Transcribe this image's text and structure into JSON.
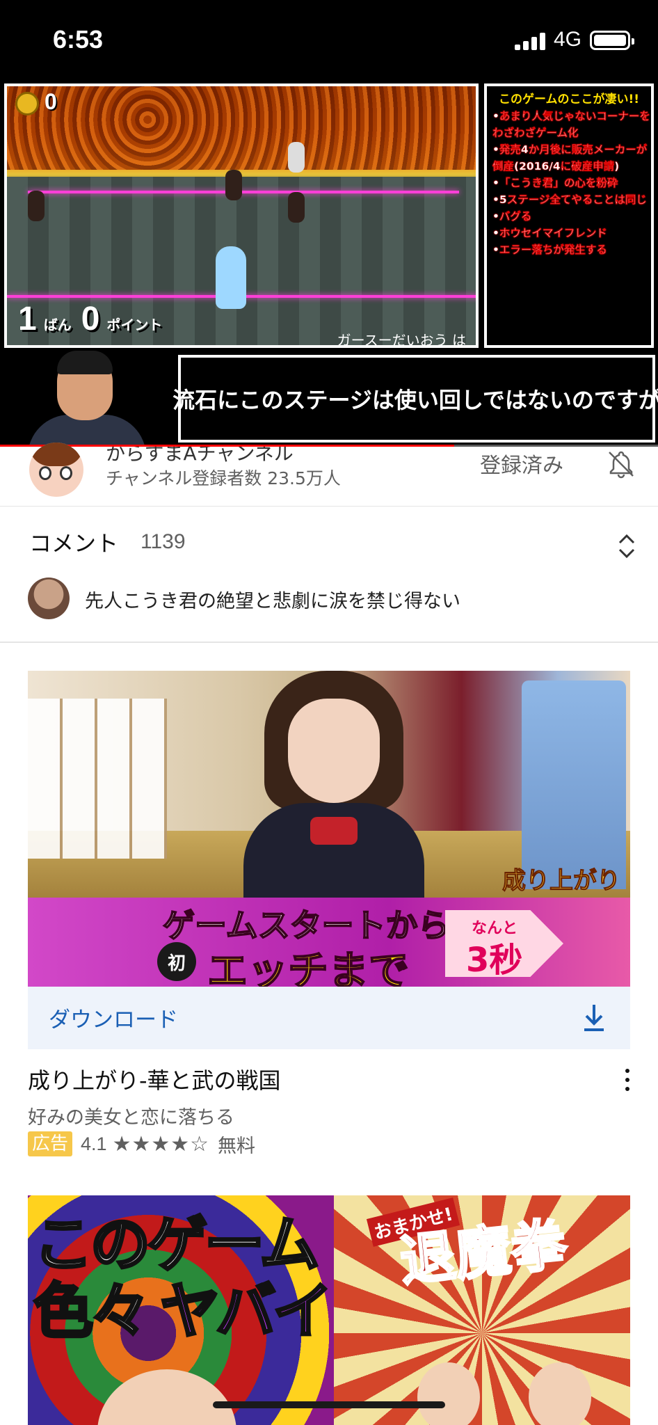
{
  "status_bar": {
    "time": "6:53",
    "network": "4G"
  },
  "video": {
    "hud_coins": "0",
    "hud_rank": "1",
    "hud_rank_unit": "ばん",
    "hud_points": "0",
    "hud_points_unit": "ポイント",
    "game_caption": "ガースーだいおう は",
    "info_panel": {
      "title": "このゲームのここが凄い!!",
      "lines": [
        "•あまり人気じゃないコーナーを",
        "  わざわざゲーム化",
        "•発売4か月後に販売メーカーが",
        "  倒産(2016/4に破産申請)",
        "•「こうき君」の心を粉砕",
        "•5ステージ全てやることは同じ",
        "•バグる",
        "•ホウセイマイフレンド",
        "•エラー落ちが発生する"
      ]
    },
    "subtitle": "流石にこのステージは使い回しではないのですが",
    "progress": 0.69
  },
  "channel": {
    "name": "からすまAチャンネル",
    "subscribers": "チャンネル登録者数 23.5万人",
    "subscribed_label": "登録済み",
    "bell_icon": "bell-off-icon"
  },
  "comments": {
    "label": "コメント",
    "count": "1139",
    "top_comment": "先人こうき君の絶望と悲劇に涙を禁じ得ない"
  },
  "ad": {
    "banner_line1": "ゲームスタートから",
    "banner_first": "初",
    "banner_line2": "エッチまで",
    "arrow_small": "なんと",
    "arrow_big": "3秒",
    "logo_text": "成り上がり",
    "download_label": "ダウンロード",
    "title": "成り上がり-華と武の戦国",
    "subtitle": "好みの美女と恋に落ちる",
    "badge": "広告",
    "rating": "4.1",
    "stars": "★★★★☆",
    "rating_value": 4.1,
    "price": "無料",
    "colors": {
      "download_text": "#1a5fb4",
      "badge_bg": "#f6c74a"
    }
  },
  "next_video": {
    "thumb_line1": "このゲーム",
    "thumb_line2a": "色々",
    "thumb_line2b": "ヤバイ",
    "thumb_logo": "退魔拳",
    "thumb_logo_small": "おまかせ!"
  }
}
